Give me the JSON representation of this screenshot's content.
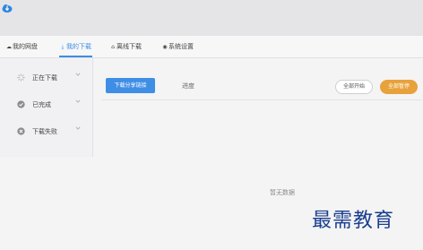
{
  "nav": {
    "tabs": [
      {
        "label": "我的网盘",
        "icon": "cloud-icon"
      },
      {
        "label": "我的下载",
        "icon": "download-icon",
        "active": true
      },
      {
        "label": "离线下载",
        "icon": "offline-icon"
      },
      {
        "label": "系统设置",
        "icon": "settings-icon"
      }
    ]
  },
  "sidebar": {
    "items": [
      {
        "label": "正在下载",
        "icon": "loading-icon"
      },
      {
        "label": "已完成",
        "icon": "check-circle-icon"
      },
      {
        "label": "下载失败",
        "icon": "error-circle-icon"
      }
    ]
  },
  "toolbar": {
    "download_share_link": "下载分享链接",
    "progress_label": "进度",
    "start_all": "全部开始",
    "pause_all": "全部暂停"
  },
  "main": {
    "empty_text": "暂无数据"
  },
  "watermark": "最需教育",
  "colors": {
    "accent": "#3c8ee6",
    "pause_button": "#e8a23b",
    "watermark": "#1a3f8f"
  }
}
